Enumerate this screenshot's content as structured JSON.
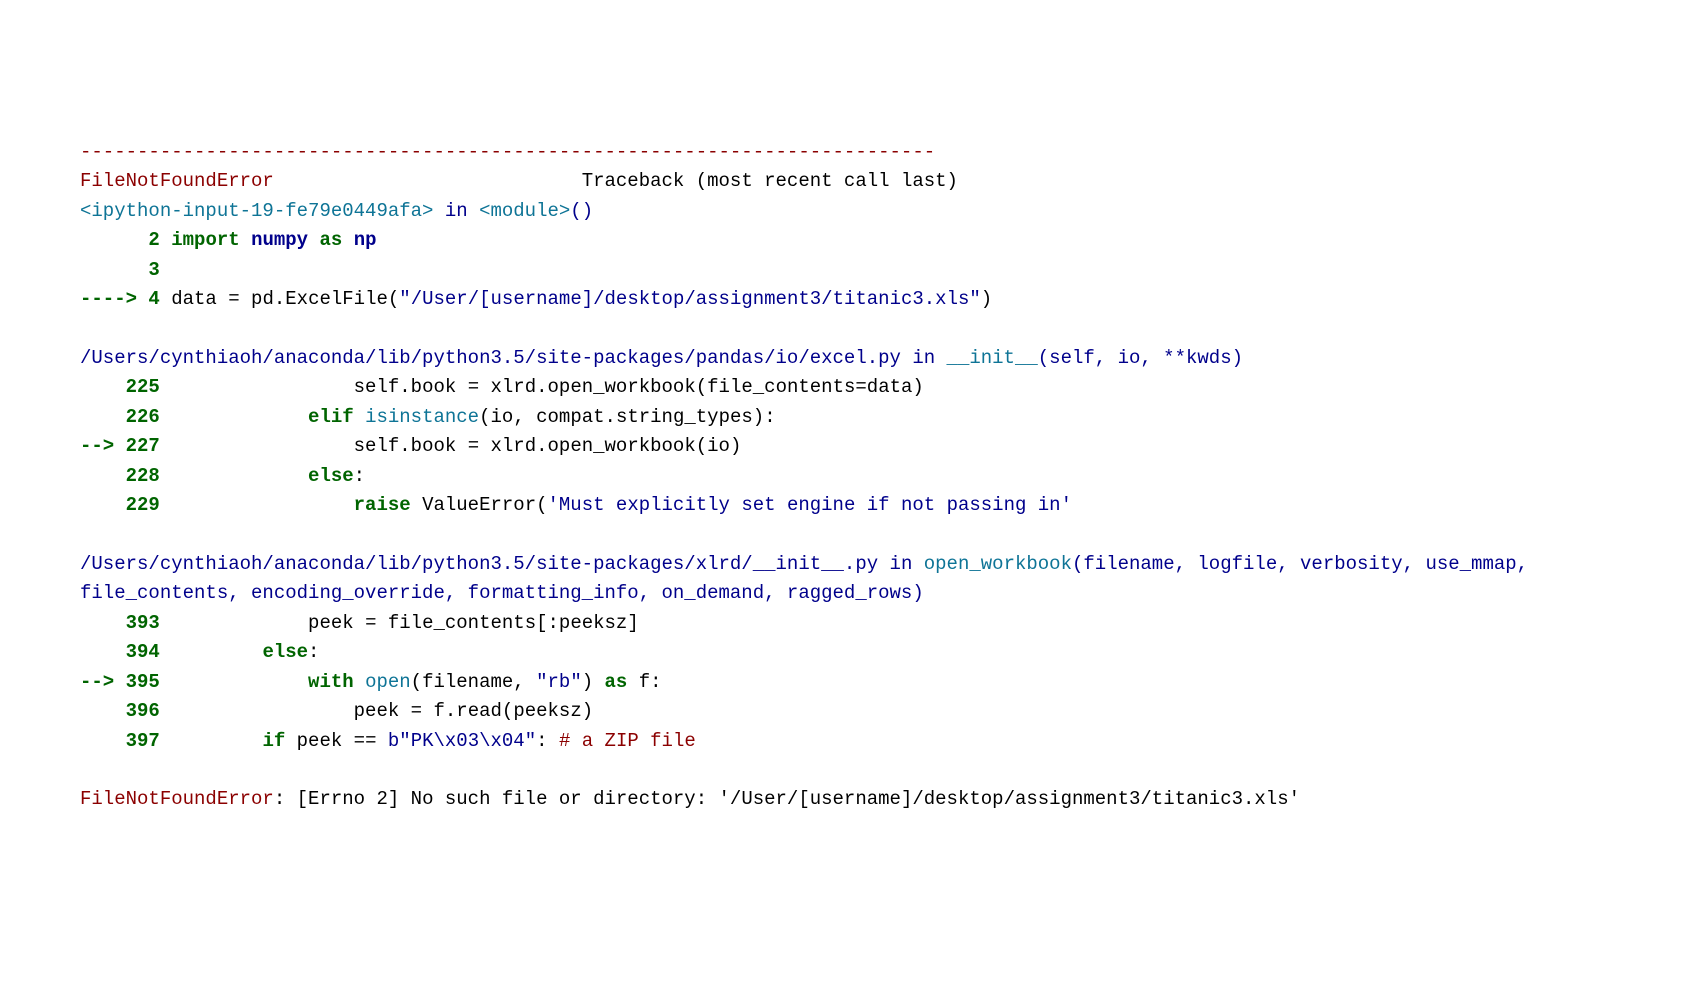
{
  "traceback": {
    "separator": "---------------------------------------------------------------------------",
    "errorType": "FileNotFoundError",
    "header": "                           Traceback (most recent call last)",
    "frame1": {
      "location": "<ipython-input-19-fe79e0449afa>",
      "suffix": " in ",
      "func": "<module>",
      "parens": "()",
      "line2": "      2 ",
      "line2_kw": "import",
      "line2_s1": " ",
      "line2_mod": "numpy",
      "line2_s2": " ",
      "line2_as": "as",
      "line2_s3": " ",
      "line2_alias": "np",
      "line3": "      3 ",
      "arrow4": "----> 4 ",
      "line4_p1": "data ",
      "line4_eq": "=",
      "line4_p2": " pd",
      "line4_dot": ".",
      "line4_p3": "ExcelFile",
      "line4_paren1": "(",
      "line4_str": "\"/User/[username]/desktop/assignment3/titanic3.xls\"",
      "line4_paren2": ")"
    },
    "frame2": {
      "path": "/Users/cynthiaoh/anaconda/lib/python3.5/site-packages/pandas/io/excel.py",
      "in": " in ",
      "func": "__init__",
      "sig": "(self, io, **kwds)",
      "l225_num": "    225 ",
      "l225_pad": "                ",
      "l225_self": "self",
      "l225_dot": ".",
      "l225_book": "book ",
      "l225_eq": "=",
      "l225_xlrd": " xlrd",
      "l225_d2": ".",
      "l225_ow": "open_workbook",
      "l225_p1": "(",
      "l225_fc": "file_contents",
      "l225_eq2": "=",
      "l225_data": "data",
      "l225_p2": ")",
      "l226_num": "    226 ",
      "l226_pad": "            ",
      "l226_elif": "elif",
      "l226_s1": " ",
      "l226_isi": "isinstance",
      "l226_p1": "(",
      "l226_io": "io",
      "l226_c": ",",
      "l226_s2": " compat",
      "l226_d": ".",
      "l226_st": "string_types",
      "l226_p2": ")",
      "l226_colon": ":",
      "l227_arr": "--> 227 ",
      "l227_pad": "                ",
      "l227_self": "self",
      "l227_d1": ".",
      "l227_book": "book ",
      "l227_eq": "=",
      "l227_xlrd": " xlrd",
      "l227_d2": ".",
      "l227_ow": "open_workbook",
      "l227_p1": "(",
      "l227_io": "io",
      "l227_p2": ")",
      "l228_num": "    228 ",
      "l228_pad": "            ",
      "l228_else": "else",
      "l228_colon": ":",
      "l229_num": "    229 ",
      "l229_pad": "                ",
      "l229_raise": "raise",
      "l229_ve": " ValueError",
      "l229_p1": "(",
      "l229_str": "'Must explicitly set engine if not passing in'"
    },
    "frame3": {
      "path": "/Users/cynthiaoh/anaconda/lib/python3.5/site-packages/xlrd/__init__.py",
      "in": " in ",
      "func": "open_workbook",
      "sig": "(filename, logfile, verbosity, use_mmap, file_contents, encoding_override, formatting_info, on_demand, ragged_rows)",
      "l393_num": "    393 ",
      "l393_pad": "            ",
      "l393_peek": "peek ",
      "l393_eq": "=",
      "l393_fc": " file_contents",
      "l393_br": "[:",
      "l393_ps": "peeksz",
      "l393_br2": "]",
      "l394_num": "    394 ",
      "l394_pad": "        ",
      "l394_else": "else",
      "l394_colon": ":",
      "l395_arr": "--> 395 ",
      "l395_pad": "            ",
      "l395_with": "with",
      "l395_s1": " ",
      "l395_open": "open",
      "l395_p1": "(",
      "l395_fn": "filename",
      "l395_c": ",",
      "l395_s2": " ",
      "l395_rb": "\"rb\"",
      "l395_p2": ")",
      "l395_s3": " ",
      "l395_as": "as",
      "l395_f": " f",
      "l395_colon": ":",
      "l396_num": "    396 ",
      "l396_pad": "                ",
      "l396_peek": "peek ",
      "l396_eq": "=",
      "l396_f": " f",
      "l396_d": ".",
      "l396_read": "read",
      "l396_p1": "(",
      "l396_ps": "peeksz",
      "l396_p2": ")",
      "l397_num": "    397 ",
      "l397_pad": "        ",
      "l397_if": "if",
      "l397_peek": " peek ",
      "l397_eq": "==",
      "l397_s": " ",
      "l397_b": "b\"PK\\x03\\x04\"",
      "l397_colon": ":",
      "l397_s2": " ",
      "l397_comment": "# a ZIP file"
    },
    "finalError": {
      "type": "FileNotFoundError",
      "msg": ": [Errno 2] No such file or directory: '/User/[username]/desktop/assignment3/titanic3.xls'"
    }
  }
}
